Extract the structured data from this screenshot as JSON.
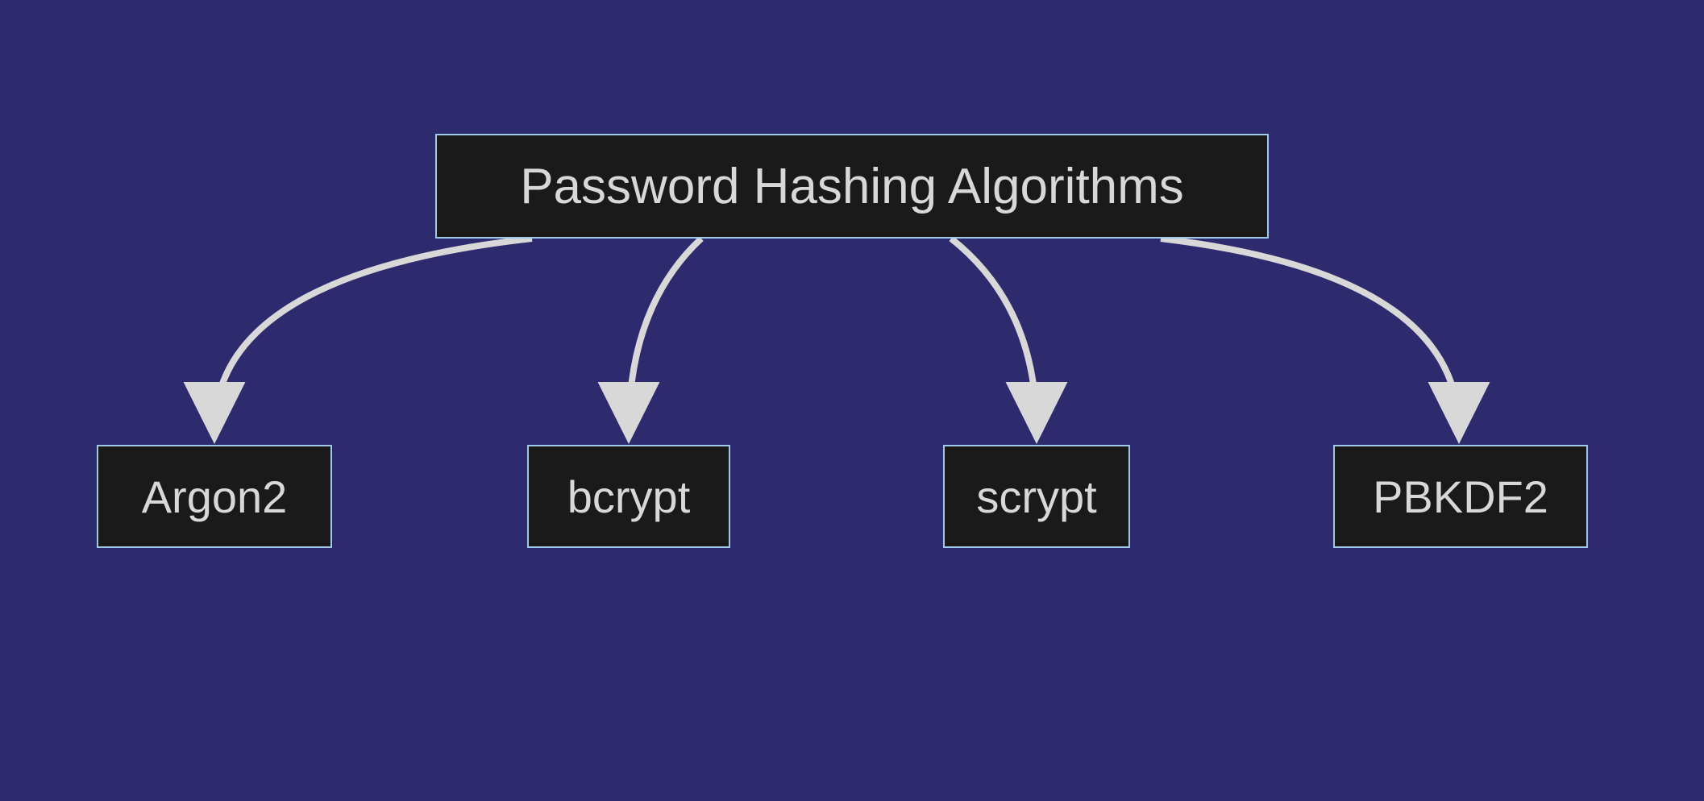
{
  "diagram": {
    "root": {
      "label": "Password Hashing Algorithms"
    },
    "children": [
      {
        "label": "Argon2"
      },
      {
        "label": "bcrypt"
      },
      {
        "label": "scrypt"
      },
      {
        "label": "PBKDF2"
      }
    ]
  },
  "colors": {
    "background": "#2e2a6e",
    "nodeBackground": "#1a1a1a",
    "nodeBorder": "#a0c8e8",
    "nodeText": "#d8d8d8",
    "arrow": "#d8d8d8"
  }
}
